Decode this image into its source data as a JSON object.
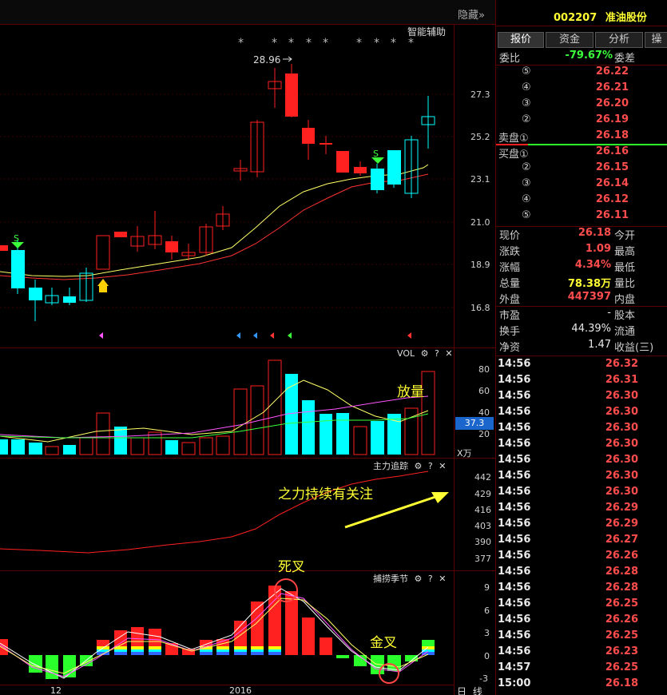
{
  "header": {
    "hide_label": "隐藏",
    "hide_icon": "double-chevron-right-icon",
    "assist_label": "智能辅助"
  },
  "stock": {
    "code": "002207",
    "name": "准油股份"
  },
  "tabs": [
    {
      "label": "报价"
    },
    {
      "label": "资金"
    },
    {
      "label": "分析"
    },
    {
      "label": "操"
    }
  ],
  "weibi": {
    "label": "委比",
    "value": "-79.67%",
    "label2": "委差"
  },
  "sell": [
    {
      "rank": "⑤",
      "price": "26.22"
    },
    {
      "rank": "④",
      "price": "26.21"
    },
    {
      "rank": "③",
      "price": "26.20"
    },
    {
      "rank": "②",
      "price": "26.19"
    },
    {
      "rank": "卖盘①",
      "price": "26.18"
    }
  ],
  "buy": [
    {
      "rank": "买盘①",
      "price": "26.16"
    },
    {
      "rank": "②",
      "price": "26.15"
    },
    {
      "rank": "③",
      "price": "26.14"
    },
    {
      "rank": "④",
      "price": "26.12"
    },
    {
      "rank": "⑤",
      "price": "26.11"
    }
  ],
  "quote": [
    {
      "label": "现价",
      "value": "26.18",
      "label2": "今开",
      "color": "#ff4d4d"
    },
    {
      "label": "涨跌",
      "value": "1.09",
      "label2": "最高",
      "color": "#ff4d4d"
    },
    {
      "label": "涨幅",
      "value": "4.34%",
      "label2": "最低",
      "color": "#ff4d4d"
    },
    {
      "label": "总量",
      "value": "78.38万",
      "label2": "量比",
      "color": "#ffff33"
    },
    {
      "label": "外盘",
      "value": "447397",
      "label2": "内盘",
      "color": "#ff4d4d"
    }
  ],
  "fundamentals": [
    {
      "label": "市盈",
      "value": "-",
      "label2": "股本"
    },
    {
      "label": "换手",
      "value": "44.39%",
      "label2": "流通"
    },
    {
      "label": "净资",
      "value": "1.47",
      "label2": "收益(三)"
    }
  ],
  "ticks": [
    {
      "time": "14:56",
      "price": "26.32"
    },
    {
      "time": "14:56",
      "price": "26.31"
    },
    {
      "time": "14:56",
      "price": "26.30"
    },
    {
      "time": "14:56",
      "price": "26.30"
    },
    {
      "time": "14:56",
      "price": "26.30"
    },
    {
      "time": "14:56",
      "price": "26.30"
    },
    {
      "time": "14:56",
      "price": "26.30"
    },
    {
      "time": "14:56",
      "price": "26.30"
    },
    {
      "time": "14:56",
      "price": "26.30"
    },
    {
      "time": "14:56",
      "price": "26.29"
    },
    {
      "time": "14:56",
      "price": "26.29"
    },
    {
      "time": "14:56",
      "price": "26.27"
    },
    {
      "time": "14:56",
      "price": "26.26"
    },
    {
      "time": "14:56",
      "price": "26.28"
    },
    {
      "time": "14:56",
      "price": "26.28"
    },
    {
      "time": "14:56",
      "price": "26.25"
    },
    {
      "time": "14:56",
      "price": "26.26"
    },
    {
      "time": "14:56",
      "price": "26.25"
    },
    {
      "time": "14:56",
      "price": "26.23"
    },
    {
      "time": "14:57",
      "price": "26.25"
    },
    {
      "time": "15:00",
      "price": "26.18"
    }
  ],
  "price_axis": [
    "27.3",
    "25.2",
    "23.1",
    "21.0",
    "18.9",
    "16.8"
  ],
  "high_label": "28.96",
  "vol_panel": {
    "title": "VOL",
    "axis": [
      "80",
      "60",
      "40",
      "20"
    ],
    "current": "37.3",
    "unit": "X万",
    "annotation": "放量"
  },
  "trend_panel": {
    "title": "主力追踪",
    "axis": [
      "442",
      "429",
      "416",
      "403",
      "390",
      "377"
    ],
    "annotation": "之力持续有关注"
  },
  "season_panel": {
    "title": "捕捞季节",
    "axis": [
      "9",
      "6",
      "3",
      "0",
      "-3"
    ],
    "dead_cross": "死叉",
    "golden_cross": "金叉"
  },
  "x_labels": [
    "12",
    "2016"
  ],
  "period_labels": [
    "日",
    "线"
  ],
  "panel_icons": [
    "gear-icon",
    "help-icon",
    "close-icon"
  ],
  "colors": {
    "up": "#ff2020",
    "down": "#00ffff",
    "ma_short": "#ffff66",
    "ma_long": "#ff3333",
    "annotation": "#ffff33"
  }
}
